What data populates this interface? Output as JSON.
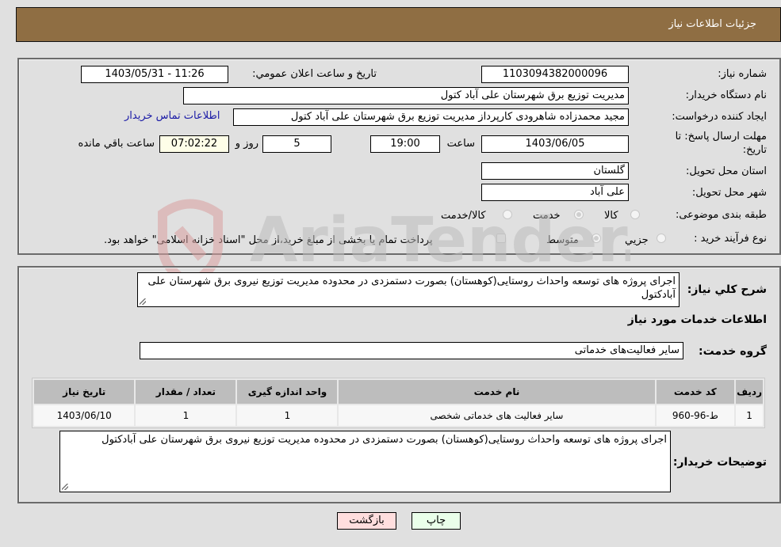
{
  "header": {
    "title": "جزئیات اطلاعات نیاز"
  },
  "fields": {
    "need_number_label": "شماره نیاز:",
    "need_number": "1103094382000096",
    "announce_label": "تاریخ و ساعت اعلان عمومي:",
    "announce_value": "1403/05/31 - 11:26",
    "buyer_org_label": "نام دستگاه خریدار:",
    "buyer_org": "مدیریت توزیع برق شهرستان علی آباد کتول",
    "creator_label": "ایجاد کننده درخواست:",
    "creator": "مجید محمدزاده شاهرودی کارپرداز مدیریت توزیع برق شهرستان علی آباد کتول",
    "contact_link": "اطلاعات تماس خریدار",
    "deadline_label_1": "مهلت ارسال پاسخ: تا",
    "deadline_label_2": "تاریخ:",
    "deadline_date": "1403/06/05",
    "time_label": "ساعت",
    "deadline_time": "19:00",
    "days_value": "5",
    "days_label": "روز و",
    "remaining_time": "07:02:22",
    "remaining_label": "ساعت باقي مانده",
    "province_label": "استان محل تحویل:",
    "province": "گلستان",
    "city_label": "شهر محل تحویل:",
    "city": "علی آباد",
    "category_label": "طبقه بندی موضوعی:",
    "category_options": [
      {
        "label": "کالا",
        "checked": false
      },
      {
        "label": "خدمت",
        "checked": true
      },
      {
        "label": "کالا/خدمت",
        "checked": false
      }
    ],
    "process_label": "نوع فرآیند خرید :",
    "process_options": [
      {
        "label": "جزيي",
        "checked": false
      },
      {
        "label": "متوسط",
        "checked": true
      }
    ],
    "payment_note": "پرداخت تمام یا بخشی از مبلغ خرید،از محل \"اسناد خزانه اسلامی\" خواهد بود."
  },
  "description": {
    "label": "شرح كلي نياز:",
    "text": "اجرای پروژه های  توسعه واحداث روستایی(کوهستان) بصورت دستمزدی در محدوده مدیریت توزیع نیروی برق شهرستان علی آبادکتول"
  },
  "services": {
    "section_title": "اطلاعات خدمات مورد نیاز",
    "group_label": "گروه خدمت:",
    "group_value": "سایر فعالیت‌های خدماتی",
    "columns": [
      "ردیف",
      "کد خدمت",
      "نام خدمت",
      "واحد اندازه گیری",
      "تعداد / مقدار",
      "تاریخ نیاز"
    ],
    "rows": [
      [
        "1",
        "ط-96-960",
        "سایر فعالیت های خدماتی شخصی",
        "1",
        "1",
        "1403/06/10"
      ]
    ]
  },
  "buyer_notes": {
    "label": "توضیحات خریدار:",
    "text": "اجرای پروژه های  توسعه واحداث روستایی(کوهستان) بصورت دستمزدی در محدوده مدیریت توزیع نیروی برق شهرستان علی آبادکتول"
  },
  "buttons": {
    "print": "چاپ",
    "back": "بازگشت"
  },
  "watermark": {
    "text": "AriaTender.neT"
  }
}
